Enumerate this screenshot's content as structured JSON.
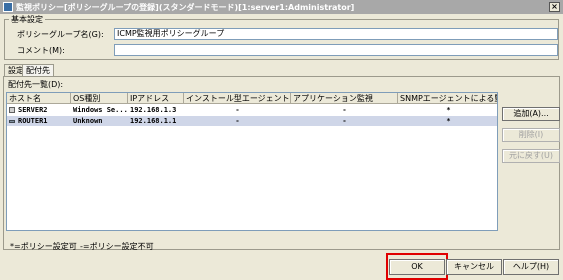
{
  "window": {
    "title": "監視ポリシー[ポリシーグループの登録](スタンダードモード)[1:server1:Administrator]",
    "close_label": "×"
  },
  "basic_settings": {
    "legend": "基本設定",
    "policy_group_name_label": "ポリシーグループ名(G):",
    "policy_group_name_value": "ICMP監視用ポリシーグループ",
    "comment_label": "コメント(M):",
    "comment_value": ""
  },
  "tabs": [
    {
      "label": "設定",
      "active": false
    },
    {
      "label": "配付先",
      "active": true
    }
  ],
  "distribution": {
    "list_caption": "配付先一覧(D):",
    "columns": [
      "ホスト名",
      "OS種別",
      "IPアドレス",
      "インストール型エージェント",
      "アプリケーション監視",
      "SNMPエージェントによる監視"
    ],
    "rows": [
      {
        "icon": "server-icon",
        "host": "SERVER2",
        "os": "Windows Se...",
        "ip": "192.168.1.3",
        "install_agent": "-",
        "app_monitor": "-",
        "snmp": "*",
        "selected": false
      },
      {
        "icon": "router-icon",
        "host": "ROUTER1",
        "os": "Unknown",
        "ip": "192.168.1.1",
        "install_agent": "-",
        "app_monitor": "-",
        "snmp": "*",
        "selected": true
      }
    ],
    "buttons": {
      "add": "追加(A)...",
      "delete": "削除(I)",
      "restore": "元に戻す(U)"
    },
    "legend_settable": "*=ポリシー設定可",
    "legend_not_settable": "-=ポリシー設定不可"
  },
  "footer": {
    "ok": "OK",
    "cancel": "キャンセル",
    "help": "ヘルプ(H)"
  },
  "colors": {
    "highlight_border": "#e00000",
    "selected_row": "#cfd6e8"
  }
}
